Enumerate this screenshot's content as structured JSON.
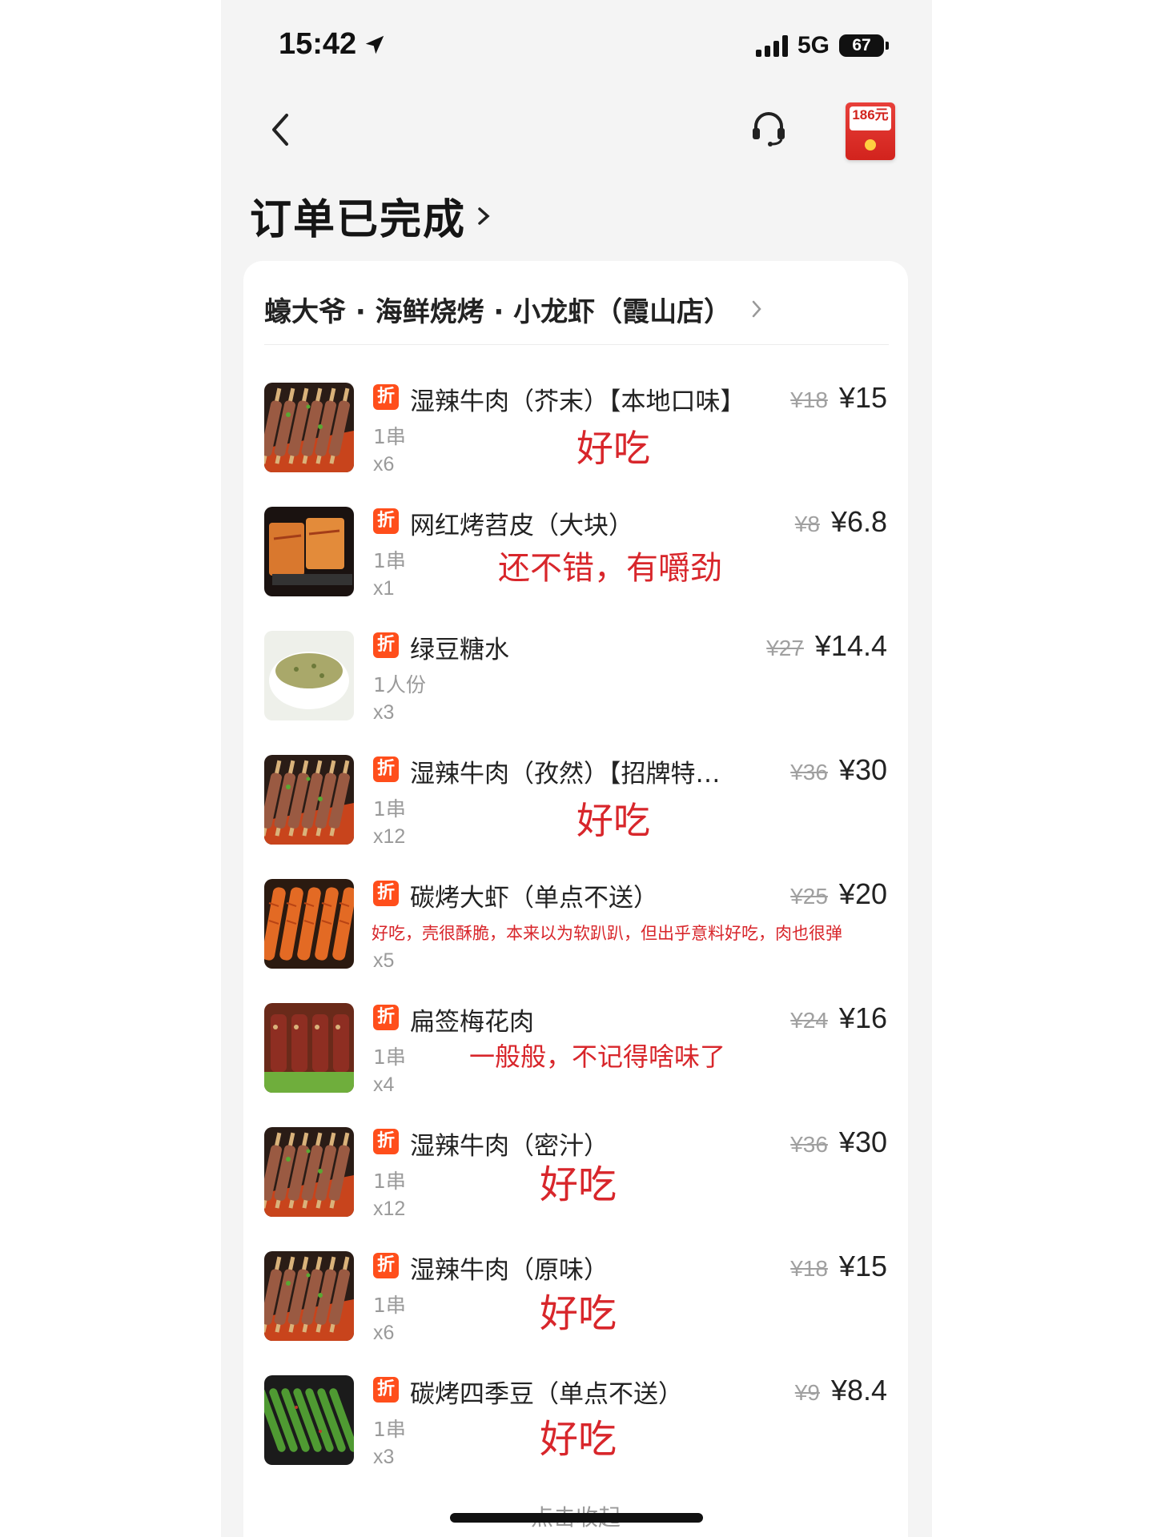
{
  "status_bar": {
    "time": "15:42",
    "network": "5G",
    "battery": "67"
  },
  "nav": {
    "redpacket_amount": "186元"
  },
  "order": {
    "title": "订单已完成"
  },
  "shop": {
    "name": "蠔大爷 · 海鲜烧烤 · 小龙虾（霞山店）"
  },
  "tag_label": "折",
  "items": [
    {
      "name": "湿辣牛肉（芥末）【本地口味】",
      "orig_price": "¥18",
      "price": "¥15",
      "spec": "1串",
      "qty": "x6",
      "note": "好吃",
      "thumb": "beef-skewers"
    },
    {
      "name": "网红烤苕皮（大块）",
      "orig_price": "¥8",
      "price": "¥6.8",
      "spec": "1串",
      "qty": "x1",
      "note": "还不错，有嚼劲",
      "thumb": "grilled-sheet"
    },
    {
      "name": "绿豆糖水",
      "orig_price": "¥27",
      "price": "¥14.4",
      "spec": "1人份",
      "qty": "x3",
      "note": "",
      "thumb": "mung-bean-soup"
    },
    {
      "name": "湿辣牛肉（孜然）【招牌特…",
      "orig_price": "¥36",
      "price": "¥30",
      "spec": "1串",
      "qty": "x12",
      "note": "好吃",
      "thumb": "beef-skewers"
    },
    {
      "name": "碳烤大虾（单点不送）",
      "orig_price": "¥25",
      "price": "¥20",
      "spec": "",
      "qty": "x5",
      "note": "好吃，壳很酥脆，本来以为软趴趴，但出乎意料好吃，肉也很弹",
      "thumb": "shrimp-skewers"
    },
    {
      "name": "扁签梅花肉",
      "orig_price": "¥24",
      "price": "¥16",
      "spec": "1串",
      "qty": "x4",
      "note": "一般般，不记得啥味了",
      "thumb": "pork-skewers"
    },
    {
      "name": "湿辣牛肉（密汁）",
      "orig_price": "¥36",
      "price": "¥30",
      "spec": "1串",
      "qty": "x12",
      "note": "好吃",
      "thumb": "beef-skewers"
    },
    {
      "name": "湿辣牛肉（原味）",
      "orig_price": "¥18",
      "price": "¥15",
      "spec": "1串",
      "qty": "x6",
      "note": "好吃",
      "thumb": "beef-skewers"
    },
    {
      "name": "碳烤四季豆（单点不送）",
      "orig_price": "¥9",
      "price": "¥8.4",
      "spec": "1串",
      "qty": "x3",
      "note": "好吃",
      "thumb": "green-beans"
    }
  ],
  "collapse_label": "点击收起",
  "colors": {
    "accent": "#ff4e1b",
    "note": "#d8262b",
    "background": "#f4f4f4"
  }
}
